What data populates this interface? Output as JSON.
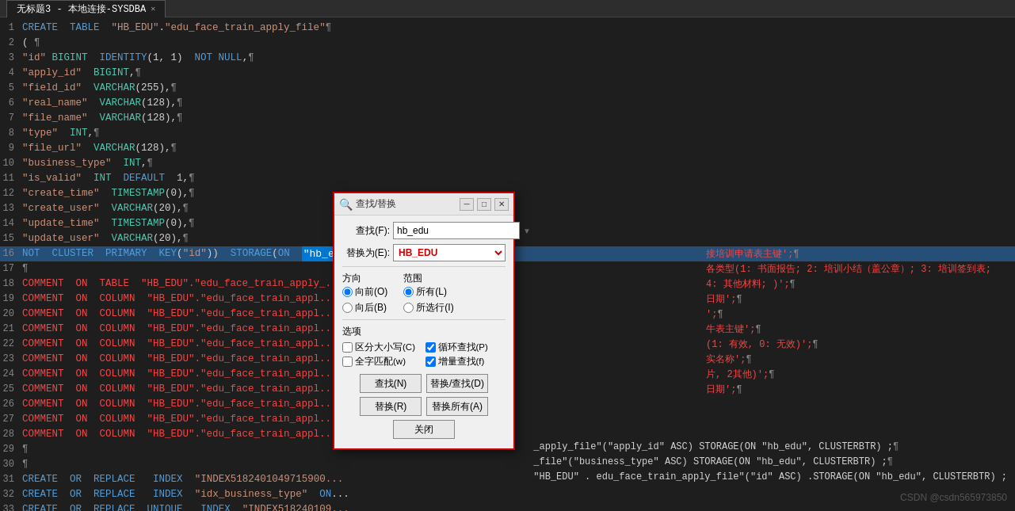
{
  "titlebar": {
    "tab_label": "无标题3 - 本地连接-SYSDBA",
    "close_label": "✕"
  },
  "editor": {
    "lines": [
      {
        "num": 1,
        "content": "CREATE  TABLE  \"HB_EDU\".\"edu_face_train_apply_file\"¶"
      },
      {
        "num": 2,
        "content": "( ¶"
      },
      {
        "num": 3,
        "content": "\"id\" BIGINT  IDENTITY(1, 1)  NOT NULL,¶"
      },
      {
        "num": 4,
        "content": "\"apply_id\"  BIGINT,¶"
      },
      {
        "num": 5,
        "content": "\"field_id\"  VARCHAR(255),¶"
      },
      {
        "num": 6,
        "content": "\"real_name\"  VARCHAR(128),¶"
      },
      {
        "num": 7,
        "content": "\"file_name\"  VARCHAR(128),¶"
      },
      {
        "num": 8,
        "content": "\"type\"  INT,¶"
      },
      {
        "num": 9,
        "content": "\"file_url\"  VARCHAR(128),¶"
      },
      {
        "num": 10,
        "content": "\"business_type\"  INT,¶"
      },
      {
        "num": 11,
        "content": "\"is_valid\"  INT  DEFAULT  1,¶"
      },
      {
        "num": 12,
        "content": "\"create_time\"  TIMESTAMP(0),¶"
      },
      {
        "num": 13,
        "content": "\"create_user\"  VARCHAR(20),¶"
      },
      {
        "num": 14,
        "content": "\"update_time\"  TIMESTAMP(0),¶"
      },
      {
        "num": 15,
        "content": "\"update_user\"  VARCHAR(20),¶"
      },
      {
        "num": 16,
        "content": "NOT  CLUSTER  PRIMARY  KEY(\"id\"))  STORAGE(ON  \"hb_e"
      },
      {
        "num": 17,
        "content": "¶"
      },
      {
        "num": 18,
        "content": "COMMENT  ON  TABLE  \"HB_EDU\".\"edu_face_train_apply_..."
      },
      {
        "num": 19,
        "content": "COMMENT  ON  COLUMN  \"HB_EDU\".\"edu_face_train_appl..."
      },
      {
        "num": 20,
        "content": "COMMENT  ON  COLUMN  \"HB_EDU\".\"edu_face_train_appl..."
      },
      {
        "num": 21,
        "content": "COMMENT  ON  COLUMN  \"HB_EDU\".\"edu_face_train_appl..."
      },
      {
        "num": 22,
        "content": "COMMENT  ON  COLUMN  \"HB_EDU\".\"edu_face_train_appl..."
      },
      {
        "num": 23,
        "content": "COMMENT  ON  COLUMN  \"HB_EDU\".\"edu_face_train_appl..."
      },
      {
        "num": 24,
        "content": "COMMENT  ON  COLUMN  \"HB_EDU\".\"edu_face_train_appl..."
      },
      {
        "num": 25,
        "content": "COMMENT  ON  COLUMN  \"HB_EDU\".\"edu_face_train_appl..."
      },
      {
        "num": 26,
        "content": "COMMENT  ON  COLUMN  \"HB_EDU\".\"edu_face_train_appl..."
      },
      {
        "num": 27,
        "content": "COMMENT  ON  COLUMN  \"HB_EDU\".\"edu_face_train_appl..."
      },
      {
        "num": 28,
        "content": "COMMENT  ON  COLUMN  \"HB_EDU\".\"edu_face_train_appl..."
      },
      {
        "num": 29,
        "content": "¶"
      },
      {
        "num": 30,
        "content": "¶"
      },
      {
        "num": 31,
        "content": "CREATE  OR  REPLACE   INDEX  \"INDEX5182401049715900..."
      },
      {
        "num": 32,
        "content": "CREATE  OR  REPLACE   INDEX  \"idx_business_type\"  ON..."
      },
      {
        "num": 33,
        "content": "CREATE  OR  REPLACE  UNIQUE   INDEX  \"INDEX518240109..."
      },
      {
        "num": 34,
        "content": "¶"
      },
      {
        "num": 35,
        "content": ""
      }
    ]
  },
  "find_replace_dialog": {
    "title": "查找/替换",
    "title_icon": "🔍",
    "find_label": "查找(F):",
    "find_value": "hb_edu",
    "replace_label": "替换为(E):",
    "replace_value": "HB_EDU",
    "direction_label": "方向",
    "forward_label": "向前(O)",
    "backward_label": "向后(B)",
    "scope_label": "范围",
    "all_label": "所有(L)",
    "selected_label": "所选行(I)",
    "options_label": "选项",
    "case_sensitive_label": "区分大小写(C)",
    "loop_find_label": "循环查找(P)",
    "full_word_label": "全字匹配(w)",
    "regex_label": "增量查找(f)",
    "find_btn": "查找(N)",
    "replace_find_btn": "替换/查找(D)",
    "replace_btn": "替换(R)",
    "replace_all_btn": "替换所有(A)",
    "close_btn": "关闭"
  },
  "watermark": "CSDN @csdn565973850"
}
